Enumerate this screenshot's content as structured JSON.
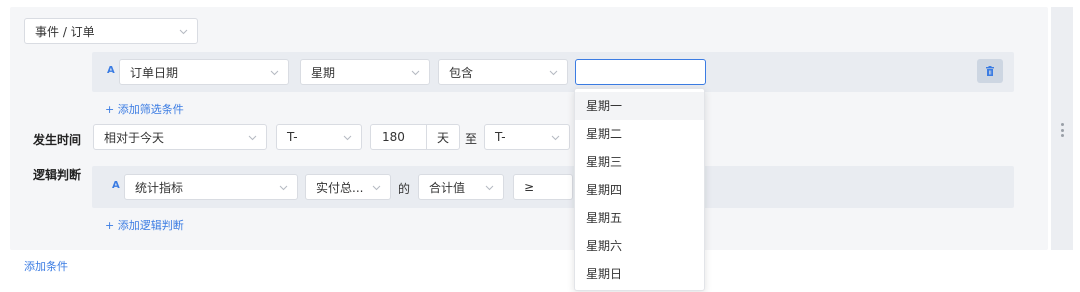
{
  "event_select": {
    "value": "事件 / 订单"
  },
  "filter_row": {
    "badge": "A",
    "field": "订单日期",
    "granularity": "星期",
    "operator": "包含",
    "value_input": ""
  },
  "add_filter_link": "+ 添加筛选条件",
  "time_row": {
    "label": "发生时间",
    "relative": "相对于今天",
    "start_prefix": "T-",
    "start_value": "180",
    "unit": "天",
    "to": "至",
    "end_prefix": "T-"
  },
  "logic_row": {
    "label": "逻辑判断",
    "badge": "A",
    "metric": "统计指标",
    "field": "实付总...",
    "of": "的",
    "aggregation": "合计值",
    "comparator": "≥"
  },
  "add_logic_link": "+ 添加逻辑判断",
  "add_condition_link": "添加条件",
  "weekday_dropdown": {
    "options": [
      "星期一",
      "星期二",
      "星期三",
      "星期四",
      "星期五",
      "星期六",
      "星期日"
    ]
  },
  "colors": {
    "accent": "#3b7ce3",
    "panel": "#f5f6f8",
    "band": "#e9ecf1"
  },
  "icons": {
    "delete": "trash-icon",
    "more": "more-vertical-icon",
    "select": "chevron-down-icon"
  }
}
